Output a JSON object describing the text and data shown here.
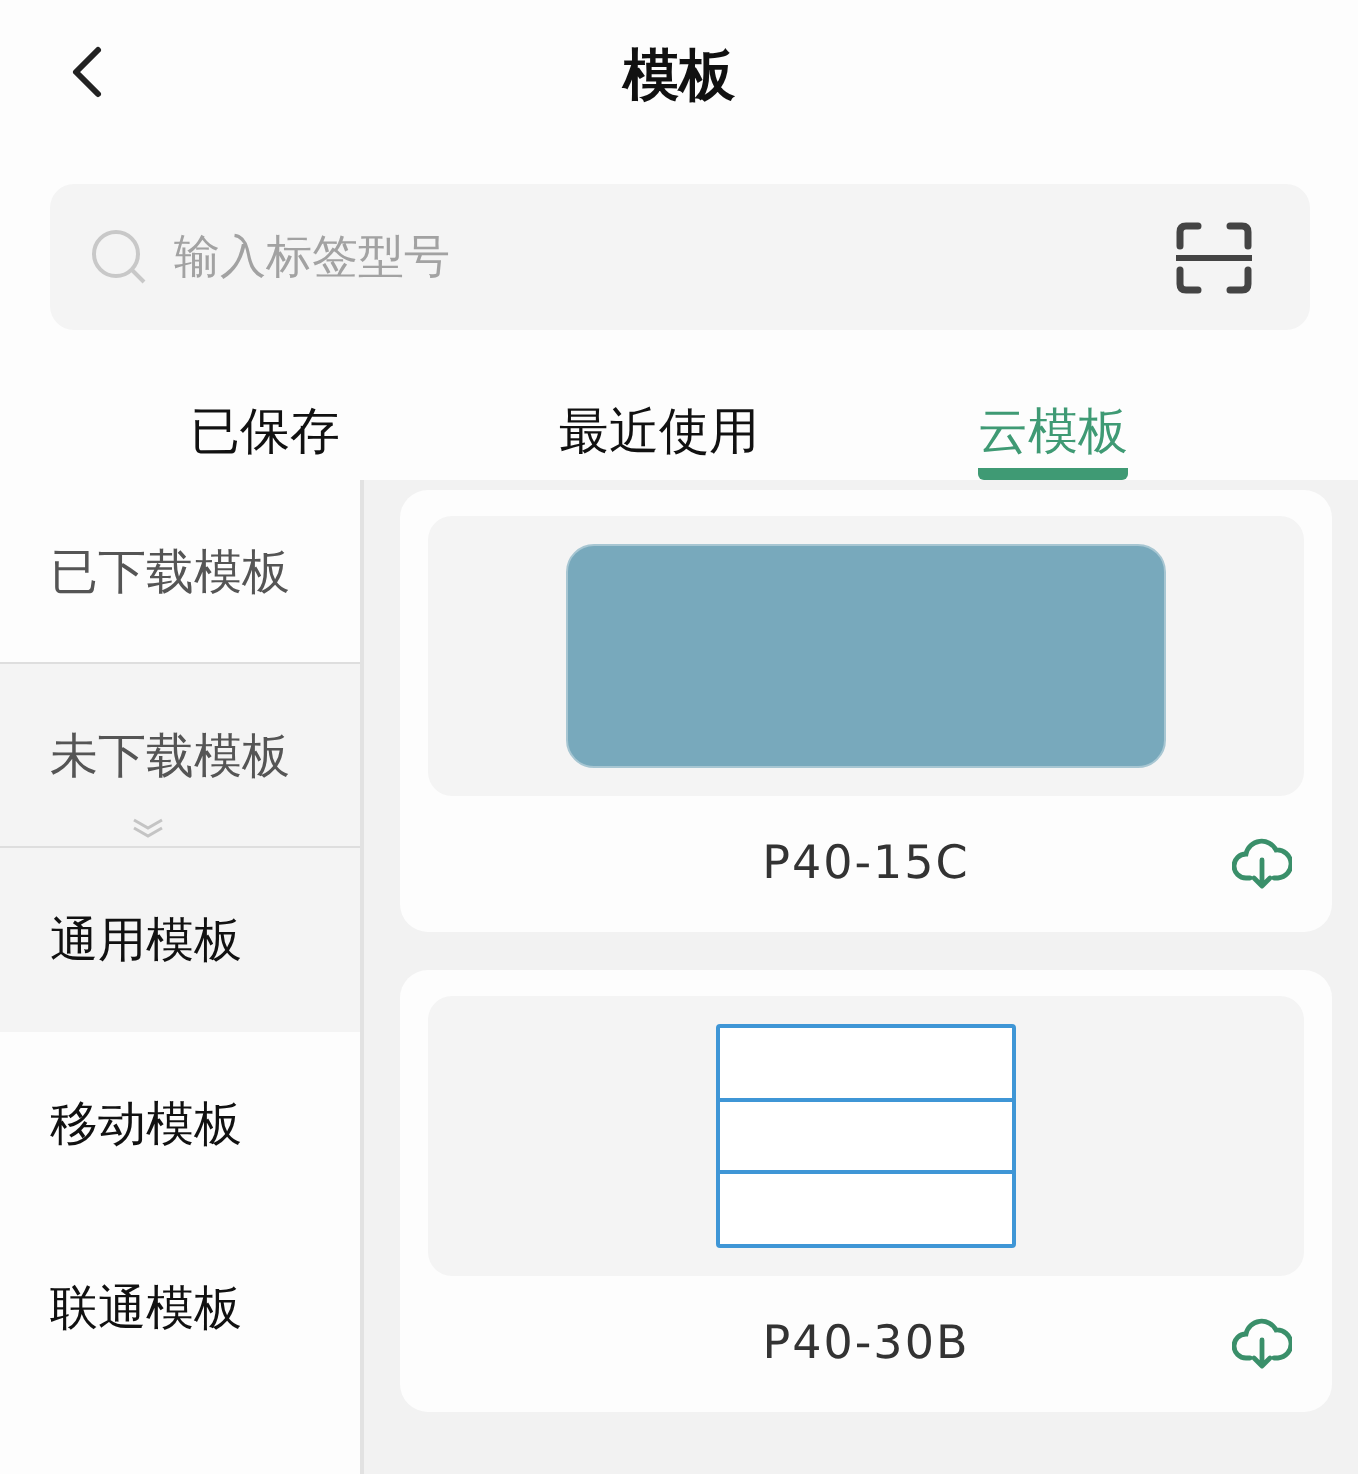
{
  "header": {
    "title": "模板"
  },
  "search": {
    "placeholder": "输入标签型号"
  },
  "tabs": [
    {
      "label": "已保存",
      "selected": false
    },
    {
      "label": "最近使用",
      "selected": false
    },
    {
      "label": "云模板",
      "selected": true
    }
  ],
  "sidebar": {
    "items": [
      {
        "label": "已下载模板",
        "expanded": false
      },
      {
        "label": "未下载模板",
        "expanded": true,
        "children": [
          {
            "label": "通用模板",
            "selected": true
          },
          {
            "label": "移动模板",
            "selected": false
          },
          {
            "label": "联通模板",
            "selected": false
          }
        ]
      }
    ]
  },
  "templates": [
    {
      "name": "P40-15C",
      "kind": "filled"
    },
    {
      "name": "P40-30B",
      "kind": "table"
    }
  ]
}
